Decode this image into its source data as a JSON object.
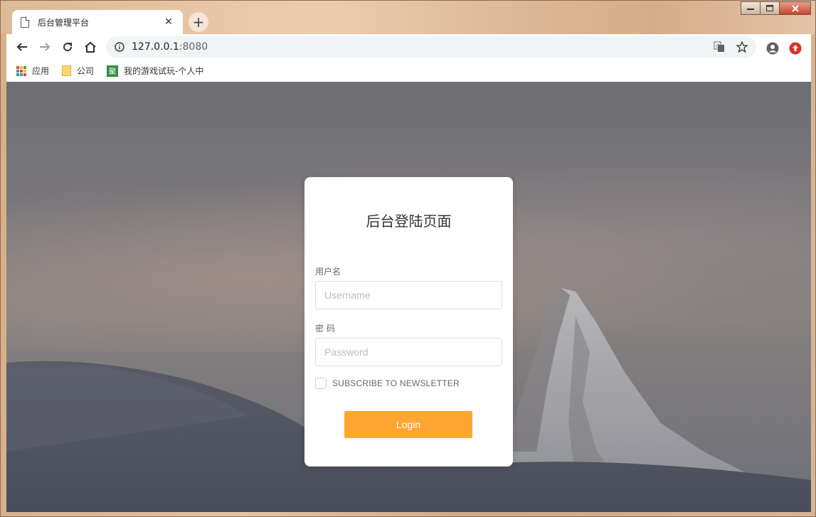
{
  "browser": {
    "tab_title": "后台管理平台",
    "tab_close": "✕",
    "new_tab": "+",
    "url_host": "127.0.0.1",
    "url_port": ":8080",
    "bookmarks": [
      {
        "label": "应用",
        "icon": "apps-icon"
      },
      {
        "label": "公司",
        "icon": "folder-icon"
      },
      {
        "label": "我的游戏试玩-个人中",
        "icon": "ju-icon",
        "icon_text": "聚"
      }
    ]
  },
  "login": {
    "title": "后台登陆页面",
    "username_label": "用户名",
    "username_placeholder": "Username",
    "username_value": "",
    "password_label": "密 码",
    "password_placeholder": "Password",
    "password_value": "",
    "subscribe_label": "SUBSCRIBE TO NEWSLETTER",
    "subscribe_checked": false,
    "login_button": "Login"
  },
  "colors": {
    "accent": "#ffa631",
    "card_bg": "#ffffff"
  }
}
